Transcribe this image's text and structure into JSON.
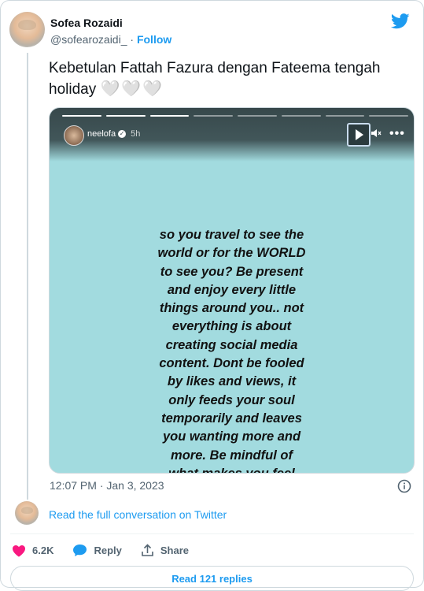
{
  "author": {
    "name": "Sofea Rozaidi",
    "handle": "@sofearozaidi_",
    "separator": "·",
    "follow_label": "Follow"
  },
  "tweet": {
    "text": "Kebetulan Fattah Fazura dengan Fateema tengah holiday",
    "hearts": "🤍🤍🤍"
  },
  "story": {
    "username": "neelofa",
    "verified_mark": "✓",
    "time_ago": "5h",
    "more_label": "•••",
    "progress_done_segments": 3,
    "progress_total_segments": 8,
    "lines": [
      "so you travel to see the",
      "world or for the WORLD",
      "to see you? Be present",
      "and enjoy every little",
      "things around you.. not",
      "everything is about",
      "creating social media",
      "content. Dont be fooled",
      "by likes and views, it",
      "only feeds your soul",
      "temporarily and leaves",
      "you wanting more and",
      "more. Be mindful of",
      "what makes you feel"
    ]
  },
  "meta": {
    "timestamp": "12:07 PM · Jan 3, 2023"
  },
  "conversation": {
    "link_text": "Read the full conversation on Twitter"
  },
  "actions": {
    "likes": "6.2K",
    "reply_label": "Reply",
    "share_label": "Share"
  },
  "replies": {
    "label": "Read 121 replies"
  },
  "colors": {
    "accent": "#1d9bf0",
    "like": "#f91880",
    "story_bg": "#a2dbdf",
    "muted_text": "#536471"
  }
}
